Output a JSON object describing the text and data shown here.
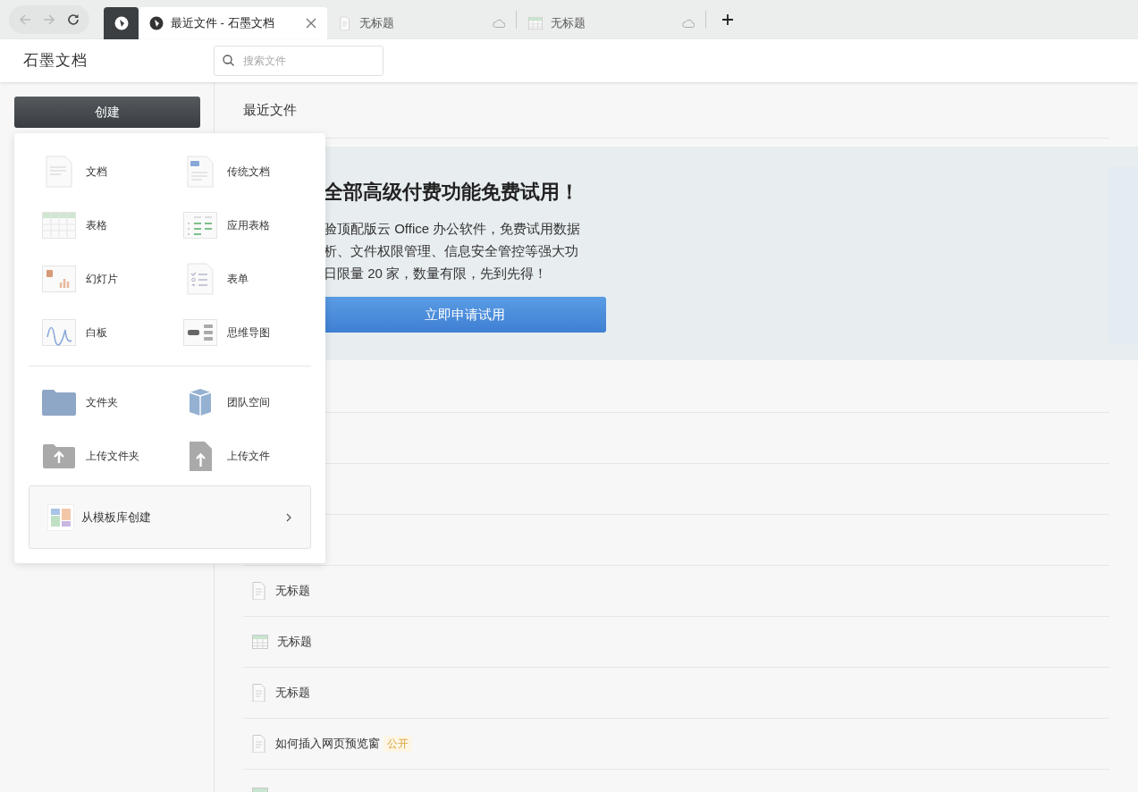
{
  "browser": {
    "tabs": [
      {
        "title": "最近文件 - 石墨文档",
        "kind": "app",
        "selected": true
      },
      {
        "title": "无标题",
        "kind": "doc",
        "selected": false
      },
      {
        "title": "无标题",
        "kind": "sheet",
        "selected": false
      }
    ]
  },
  "header": {
    "logo": "石墨文档",
    "search": {
      "placeholder": "搜索文件"
    }
  },
  "sidebar": {
    "create_button": "创建"
  },
  "create_menu": {
    "items": [
      {
        "label": "文档",
        "kind": "doc"
      },
      {
        "label": "传统文档",
        "kind": "word"
      },
      {
        "label": "表格",
        "kind": "sheet"
      },
      {
        "label": "应用表格",
        "kind": "appsheet"
      },
      {
        "label": "幻灯片",
        "kind": "slides"
      },
      {
        "label": "表单",
        "kind": "form"
      },
      {
        "label": "白板",
        "kind": "whiteboard"
      },
      {
        "label": "思维导图",
        "kind": "mindmap"
      }
    ],
    "more_items": [
      {
        "label": "文件夹",
        "kind": "folder"
      },
      {
        "label": "团队空间",
        "kind": "team"
      },
      {
        "label": "上传文件夹",
        "kind": "upload-folder"
      },
      {
        "label": "上传文件",
        "kind": "upload-file"
      }
    ],
    "template": "从模板库创建"
  },
  "main": {
    "title": "最近文件",
    "banner": {
      "title": "全部高级付费功能免费试用！",
      "lines": [
        "验顶配版云 Office 办公软件，免费试用数据",
        "析、文件权限管理、信息安全管控等强大功",
        "日限量 20 家，数量有限，先到先得！"
      ],
      "button": "立即申请试用"
    },
    "files": [
      {
        "name": "无标题",
        "kind": "doc"
      },
      {
        "name": "无标题",
        "kind": "sheet"
      },
      {
        "name": "无标题",
        "kind": "doc"
      },
      {
        "name": "如何插入网页预览窗",
        "kind": "doc",
        "tag": "公开"
      },
      {
        "kind": "sheet"
      }
    ]
  }
}
